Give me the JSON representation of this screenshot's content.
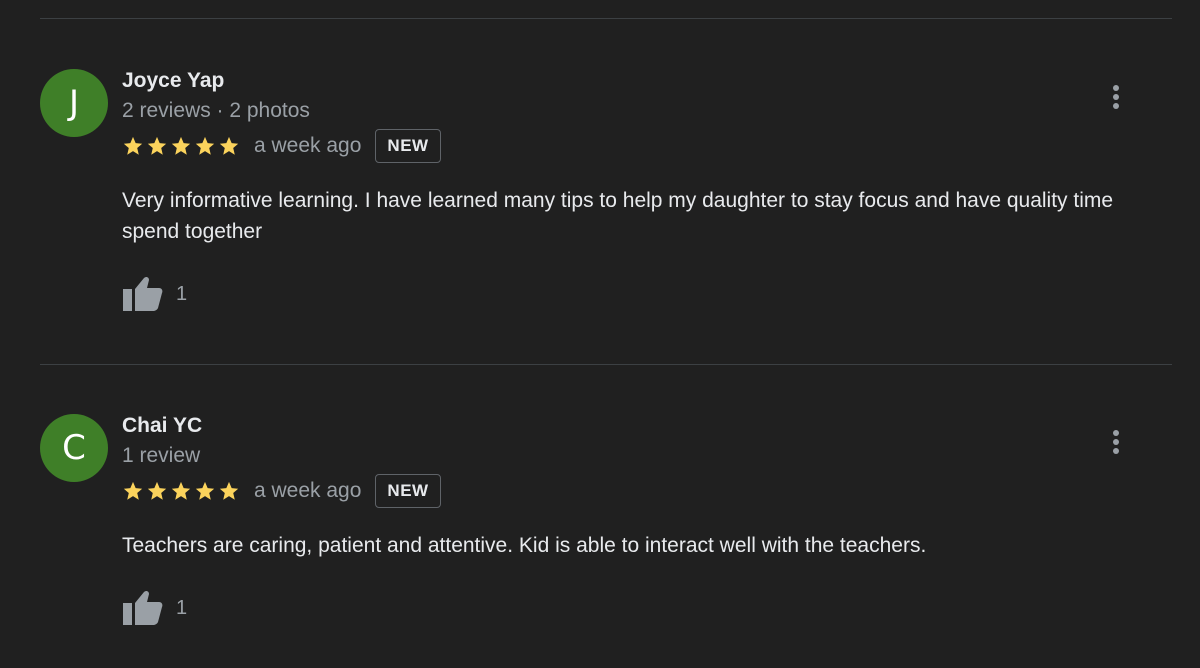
{
  "reviews": [
    {
      "avatar_letter": "J",
      "name": "Joyce Yap",
      "meta": "2 reviews · 2 photos",
      "rating": 5,
      "time": "a week ago",
      "badge": "NEW",
      "text": "Very informative learning. I have learned many tips to help my daughter to stay focus and have quality time spend together",
      "likes": "1"
    },
    {
      "avatar_letter": "C",
      "name": "Chai YC",
      "meta": "1 review",
      "rating": 5,
      "time": "a week ago",
      "badge": "NEW",
      "text": "Teachers are caring, patient and attentive. Kid is able to interact well with the teachers.",
      "likes": "1"
    }
  ],
  "icons": {
    "star": "star-icon",
    "like": "thumbs-up-icon",
    "more": "more-vert-icon"
  },
  "colors": {
    "background": "#202020",
    "avatar": "#3f7f28",
    "star": "#fbd35c",
    "muted_text": "#9aa0a6"
  }
}
